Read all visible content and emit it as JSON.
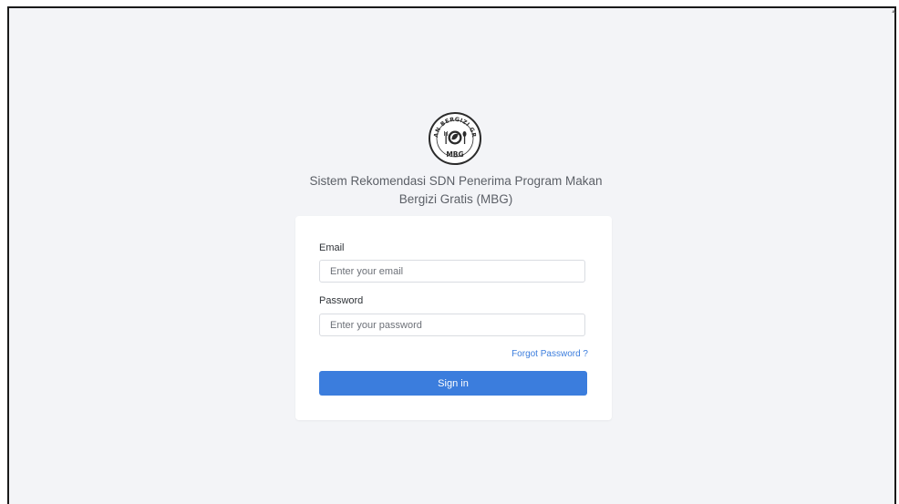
{
  "header": {
    "title": "Sistem Rekomendasi SDN Penerima Program Makan Bergizi Gratis (MBG)"
  },
  "logo": {
    "ring_text": "MAKAN BERGIZI GRATIS",
    "abbr": "MBG"
  },
  "form": {
    "email_label": "Email",
    "email_placeholder": "Enter your email",
    "password_label": "Password",
    "password_placeholder": "Enter your password",
    "forgot_label": "Forgot Password ?",
    "signin_label": "Sign in"
  },
  "colors": {
    "accent": "#3b7ddd",
    "page_background": "#f3f4f7",
    "card_background": "#ffffff"
  }
}
